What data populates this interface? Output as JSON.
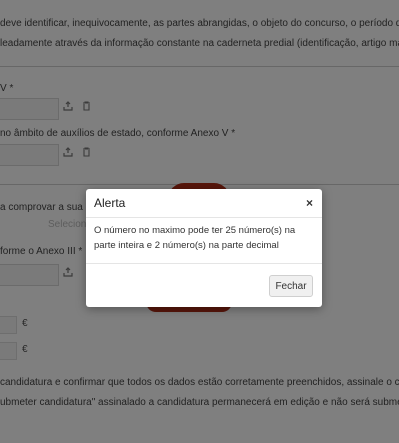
{
  "background": {
    "intro_line1": "deve identificar, inequivocamente, as partes abrangidas, o objeto do concurso, o período de vigên",
    "intro_line2": "leadamente através da informação constante na caderneta predial (identificação, artigo matricial,",
    "field1_label": "V *",
    "field2_label": "no âmbito de auxílios de estado, conforme Anexo V *",
    "field3_label": "a comprovar a sua",
    "field3_placeholder": "Selecione",
    "field4_label": "forme o Anexo III *",
    "euro_symbol_1": "€",
    "euro_symbol_2": "€",
    "footer_line1": "candidatura e confirmar que todos os dados estão corretamente preenchidos, assinale o car",
    "footer_line2": "ubmeter candidatura\" assinalado a candidatura permanecerá em edição e não será submeti"
  },
  "icons": {
    "upload": "upload-icon",
    "trash": "trash-icon",
    "close": "close-icon"
  },
  "modal": {
    "title": "Alerta",
    "close_symbol": "×",
    "message": "O número no maximo pode ter 25 número(s) na parte inteira e 2 número(s) na parte decimal",
    "button_label": "Fechar"
  },
  "colors": {
    "backdrop": "rgba(0,0,0,0.5)",
    "accent_red": "#b12c17",
    "modal_background": "#ffffff"
  }
}
